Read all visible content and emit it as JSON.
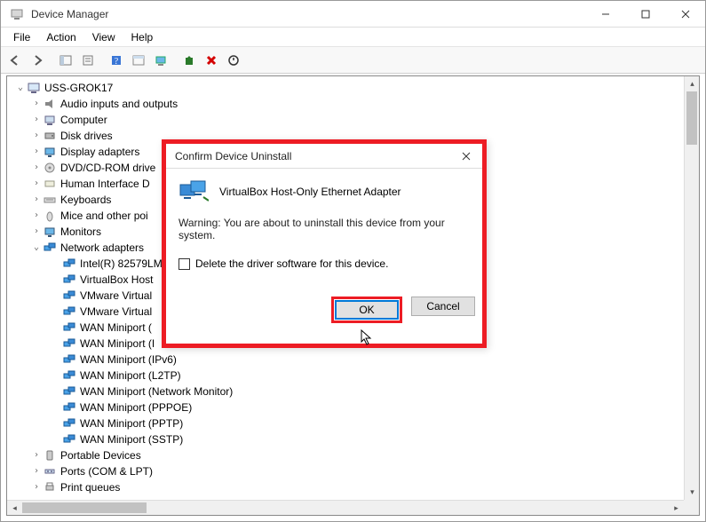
{
  "window": {
    "title": "Device Manager"
  },
  "menubar": [
    "File",
    "Action",
    "View",
    "Help"
  ],
  "tree": {
    "root": "USS-GROK17",
    "categories": [
      {
        "label": "Audio inputs and outputs",
        "expanded": false,
        "icon": "speaker"
      },
      {
        "label": "Computer",
        "expanded": false,
        "icon": "computer"
      },
      {
        "label": "Disk drives",
        "expanded": false,
        "icon": "disk"
      },
      {
        "label": "Display adapters",
        "expanded": false,
        "icon": "monitor"
      },
      {
        "label": "DVD/CD-ROM drive",
        "expanded": false,
        "icon": "disc",
        "truncated": true
      },
      {
        "label": "Human Interface D",
        "expanded": false,
        "icon": "hid",
        "truncated": true
      },
      {
        "label": "Keyboards",
        "expanded": false,
        "icon": "keyboard"
      },
      {
        "label": "Mice and other poi",
        "expanded": false,
        "icon": "mouse",
        "truncated": true
      },
      {
        "label": "Monitors",
        "expanded": false,
        "icon": "monitor"
      },
      {
        "label": "Network adapters",
        "expanded": true,
        "icon": "net",
        "children": [
          "Intel(R) 82579LM",
          "VirtualBox Host",
          "VMware Virtual ",
          "VMware Virtual ",
          "WAN Miniport (",
          "WAN Miniport (I",
          "WAN Miniport (IPv6)",
          "WAN Miniport (L2TP)",
          "WAN Miniport (Network Monitor)",
          "WAN Miniport (PPPOE)",
          "WAN Miniport (PPTP)",
          "WAN Miniport (SSTP)"
        ]
      },
      {
        "label": "Portable Devices",
        "expanded": false,
        "icon": "portable"
      },
      {
        "label": "Ports (COM & LPT)",
        "expanded": false,
        "icon": "port"
      },
      {
        "label": "Print queues",
        "expanded": false,
        "icon": "printer"
      }
    ]
  },
  "dialog": {
    "title": "Confirm Device Uninstall",
    "device_name": "VirtualBox Host-Only Ethernet Adapter",
    "warning": "Warning: You are about to uninstall this device from your system.",
    "checkbox_label": "Delete the driver software for this device.",
    "checkbox_checked": false,
    "ok_label": "OK",
    "cancel_label": "Cancel"
  }
}
